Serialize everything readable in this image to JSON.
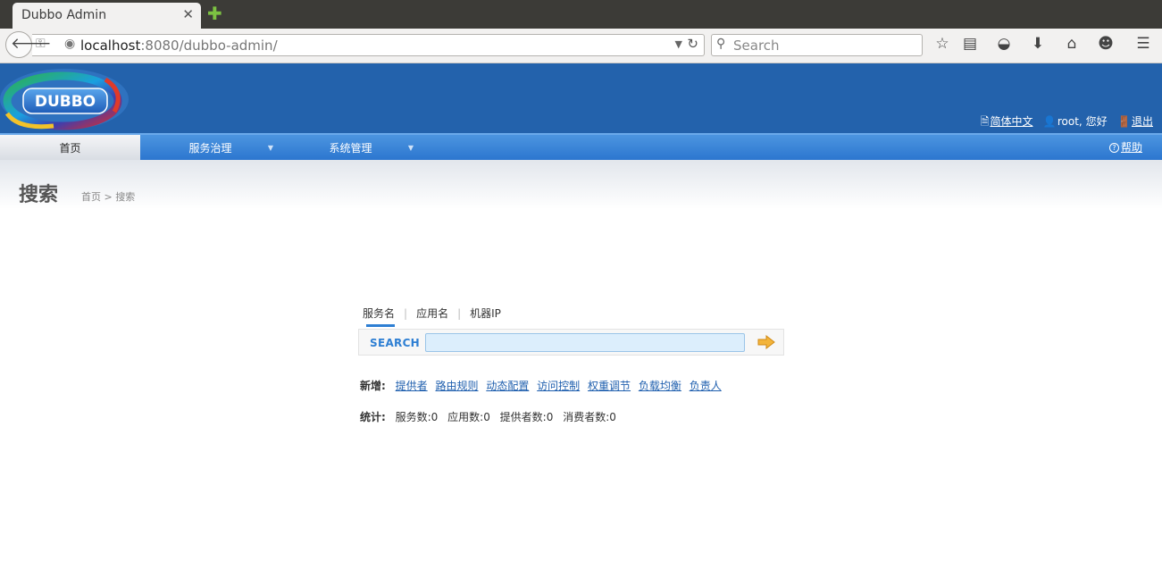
{
  "browser": {
    "tab_title": "Dubbo Admin",
    "tab_close": "✕",
    "new_tab": "✚",
    "url_host": "localhost",
    "url_rest": ":8080/dubbo-admin/",
    "search_placeholder": "Search",
    "toolbar_icons": [
      "bookmark-star-icon",
      "reading-list-icon",
      "pocket-icon",
      "download-icon",
      "home-icon",
      "hello-icon",
      "menu-icon"
    ]
  },
  "header": {
    "logo_text": "DUBBO",
    "language_link": "简体中文",
    "user_text": "root, 您好",
    "logout_link": "退出"
  },
  "menu": {
    "home": "首页",
    "service": "服务治理",
    "system": "系统管理",
    "help": "帮助"
  },
  "page": {
    "title": "搜索",
    "breadcrumb": "首页 > 搜索"
  },
  "search": {
    "tabs": [
      "服务名",
      "应用名",
      "机器IP"
    ],
    "separator": "|",
    "label": "SEARCH",
    "value": ""
  },
  "add": {
    "label": "新增:",
    "links": [
      "提供者",
      "路由规则",
      "动态配置",
      "访问控制",
      "权重调节",
      "负载均衡",
      "负责人"
    ]
  },
  "stats": {
    "label": "统计:",
    "items": [
      "服务数:0",
      "应用数:0",
      "提供者数:0",
      "消费者数:0"
    ]
  },
  "colors": {
    "header_blue": "#2362ac",
    "menu_blue": "#2c76cf",
    "link_blue": "#1f5fae",
    "accent_blue": "#2e7fd3",
    "go_arrow": "#f3b43a"
  }
}
